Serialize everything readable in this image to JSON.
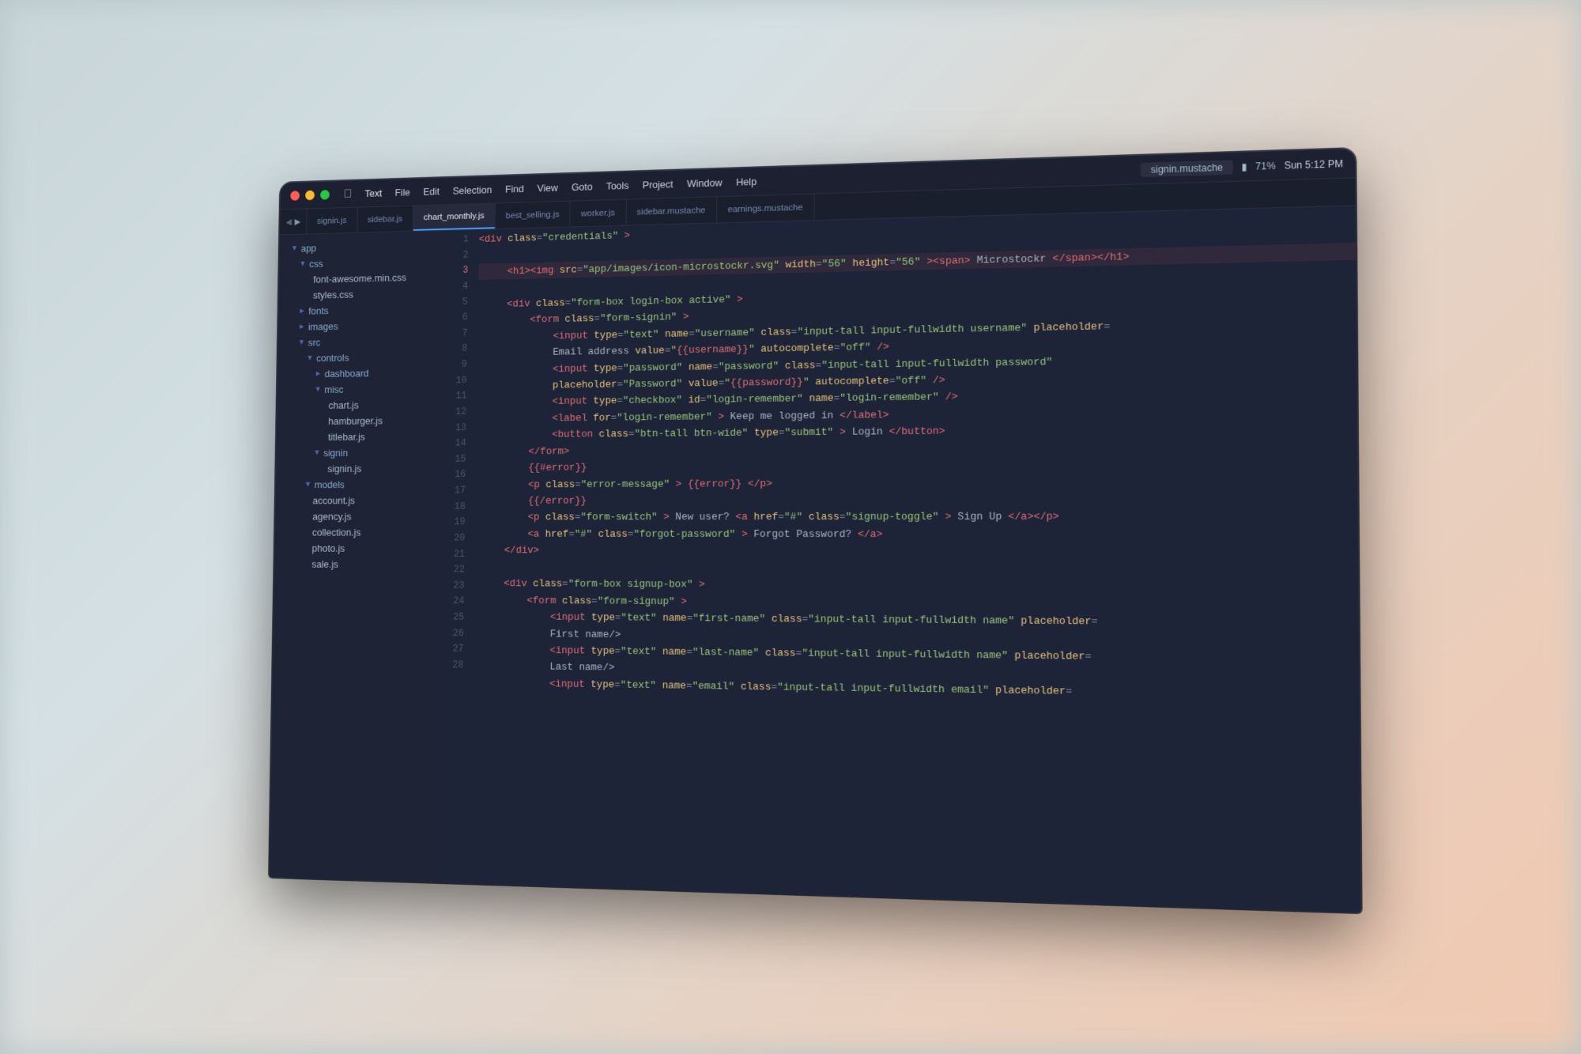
{
  "titlebar": {
    "apple_symbol": "",
    "menus": [
      "Text",
      "File",
      "Edit",
      "Selection",
      "Find",
      "View",
      "Goto",
      "Tools",
      "Project",
      "Window",
      "Help"
    ],
    "filename": "signin.mustache",
    "battery": "71%",
    "time": "Sun 5:12 PM"
  },
  "tabs": [
    {
      "label": "signin.js",
      "active": false
    },
    {
      "label": "sidebar.js",
      "active": false
    },
    {
      "label": "chart_monthly.js",
      "active": true
    },
    {
      "label": "best_selling.js",
      "active": false
    },
    {
      "label": "worker.js",
      "active": false
    },
    {
      "label": "sidebar.mustache",
      "active": false
    },
    {
      "label": "earnings.mustache",
      "active": false
    }
  ],
  "sidebar": {
    "items": [
      {
        "type": "folder",
        "label": "app",
        "indent": 1,
        "open": true
      },
      {
        "type": "folder",
        "label": "css",
        "indent": 2,
        "open": true
      },
      {
        "type": "file",
        "label": "font-awesome.min.css",
        "indent": 3
      },
      {
        "type": "file",
        "label": "styles.css",
        "indent": 3
      },
      {
        "type": "folder",
        "label": "fonts",
        "indent": 2,
        "open": false
      },
      {
        "type": "folder",
        "label": "images",
        "indent": 2,
        "open": false
      },
      {
        "type": "folder",
        "label": "src",
        "indent": 2,
        "open": true
      },
      {
        "type": "folder",
        "label": "controls",
        "indent": 3,
        "open": true
      },
      {
        "type": "folder",
        "label": "dashboard",
        "indent": 4,
        "open": false
      },
      {
        "type": "folder",
        "label": "misc",
        "indent": 4,
        "open": true
      },
      {
        "type": "file",
        "label": "chart.js",
        "indent": 5
      },
      {
        "type": "file",
        "label": "hamburger.js",
        "indent": 5
      },
      {
        "type": "file",
        "label": "titlebar.js",
        "indent": 5
      },
      {
        "type": "folder",
        "label": "signin",
        "indent": 4,
        "open": true
      },
      {
        "type": "file",
        "label": "signin.js",
        "indent": 5
      },
      {
        "type": "folder",
        "label": "models",
        "indent": 3,
        "open": true
      },
      {
        "type": "file",
        "label": "account.js",
        "indent": 4
      },
      {
        "type": "file",
        "label": "agency.js",
        "indent": 4
      },
      {
        "type": "file",
        "label": "collection.js",
        "indent": 4
      },
      {
        "type": "file",
        "label": "photo.js",
        "indent": 4
      },
      {
        "type": "file",
        "label": "sale.js",
        "indent": 4
      }
    ]
  },
  "line_numbers": [
    1,
    2,
    3,
    4,
    5,
    6,
    7,
    8,
    9,
    10,
    11,
    12,
    13,
    14,
    15,
    16,
    17,
    18,
    19,
    20,
    21,
    22,
    23,
    24,
    25,
    26,
    27,
    28
  ],
  "code_lines": [
    {
      "content": "&lt;div class=\"credentials\"&gt;"
    },
    {
      "content": ""
    },
    {
      "content": "    &lt;h1&gt;&lt;img src=\"app/images/icon-microstockr.svg\" width=\"56\" height=\"56\"&gt;&lt;span&gt;Microstockr&lt;/span&gt;&lt;/h1&gt;",
      "highlight": true
    },
    {
      "content": ""
    },
    {
      "content": "    &lt;div class=\"form-box login-box active\"&gt;"
    },
    {
      "content": "        &lt;form class=\"form-signin\"&gt;"
    },
    {
      "content": "            &lt;input type=\"text\" name=\"username\" class=\"input-tall input-fullwidth username\" placeholder="
    },
    {
      "content": "            Email address value=\"{{username}}\" autocomplete=\"off\"/&gt;"
    },
    {
      "content": "            &lt;input type=\"password\" name=\"password\" class=\"input-tall input-fullwidth password\""
    },
    {
      "content": "            placeholder=\"Password\" value=\"{{password}}\" autocomplete=\"off\"/&gt;"
    },
    {
      "content": "            &lt;input type=\"checkbox\" id=\"login-remember\" name=\"login-remember\" /&gt;"
    },
    {
      "content": "            &lt;label for=\"login-remember\"&gt;Keep me logged in&lt;/label&gt;"
    },
    {
      "content": "            &lt;button class=\"btn-tall btn-wide\" type=\"submit\"&gt;Login&lt;/button&gt;"
    },
    {
      "content": "        &lt;/form&gt;"
    },
    {
      "content": "        {{#error}}"
    },
    {
      "content": "        &lt;p class=\"error-message\"&gt;{{error}}&lt;/p&gt;"
    },
    {
      "content": "        {{/error}}"
    },
    {
      "content": "        &lt;p class=\"form-switch\"&gt;New user? &lt;a href=\"#\" class=\"signup-toggle\"&gt;Sign Up&lt;/a&gt;&lt;/p&gt;"
    },
    {
      "content": "        &lt;a href=\"#\" class=\"forgot-password\"&gt;Forgot Password?&lt;/a&gt;"
    },
    {
      "content": "    &lt;/div&gt;"
    },
    {
      "content": ""
    },
    {
      "content": "    &lt;div class=\"form-box signup-box\"&gt;"
    },
    {
      "content": "        &lt;form class=\"form-signup\"&gt;"
    },
    {
      "content": "            &lt;input type=\"text\" name=\"first-name\" class=\"input-tall input-fullwidth name\" placeholder="
    },
    {
      "content": "            First name/&gt;"
    },
    {
      "content": "            &lt;input type=\"text\" name=\"last-name\" class=\"input-tall input-fullwidth name\" placeholder="
    },
    {
      "content": "            Last name/&gt;"
    },
    {
      "content": "            &lt;input type=\"text\" name=\"email\" class=\"input-tall input-fullwidth email\" placeholder="
    }
  ]
}
